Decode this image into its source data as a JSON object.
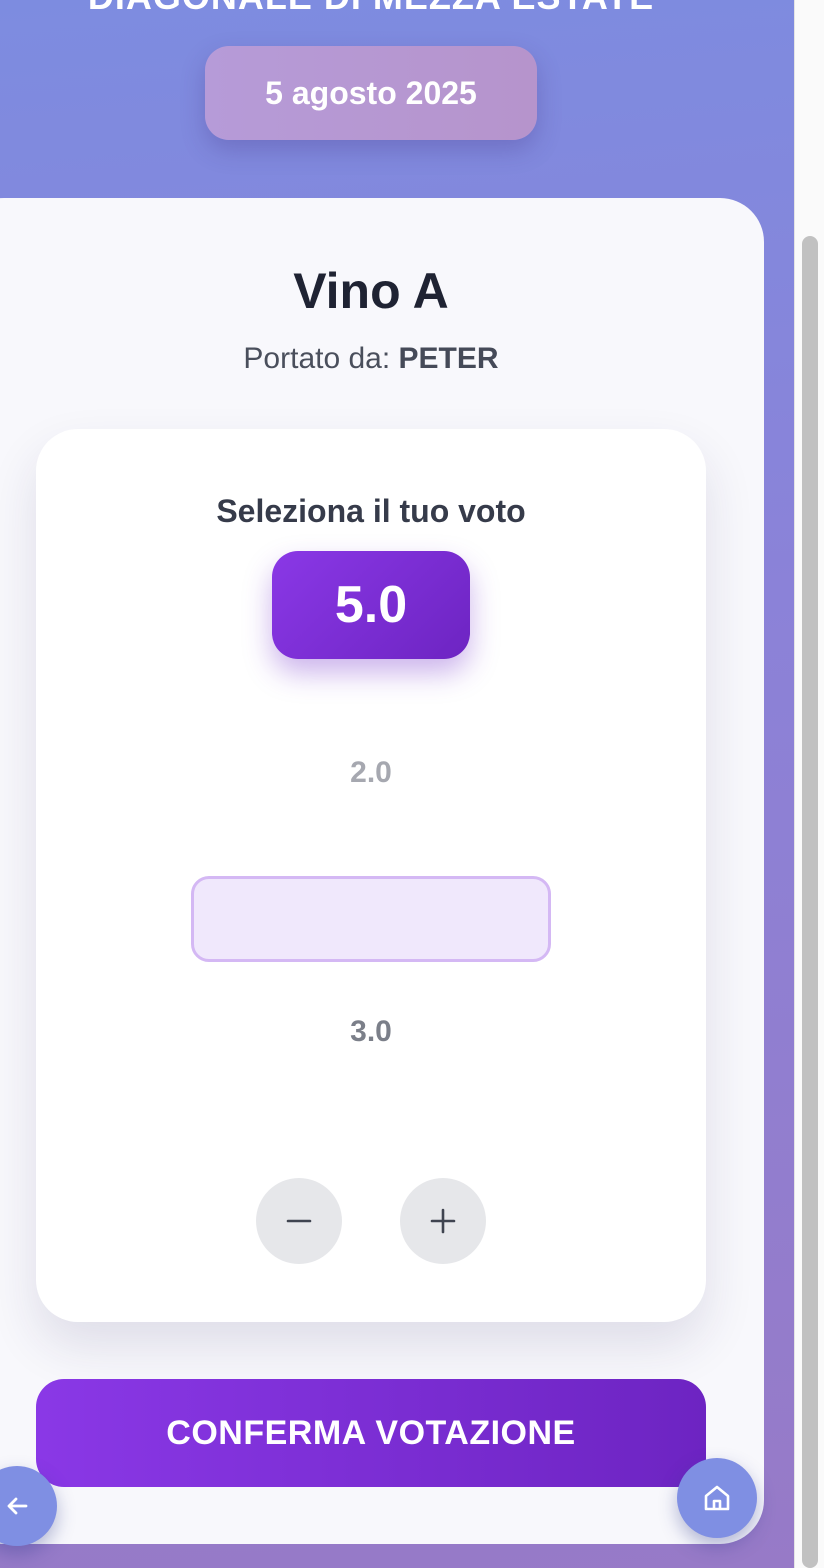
{
  "header": {
    "title": "DIAGONALE DI MEZZA ESTATE",
    "date": "5 agosto 2025"
  },
  "wine": {
    "name": "Vino A",
    "brought_by_label": "Portato da:",
    "brought_by_name": "PETER"
  },
  "vote": {
    "label": "Seleziona il tuo voto",
    "selected_value": "5.0",
    "picker_options": [
      "2.0",
      "3.0"
    ],
    "decrement_icon": "minus-icon",
    "increment_icon": "plus-icon"
  },
  "actions": {
    "confirm_label": "CONFERMA VOTAZIONE",
    "back_icon": "arrow-left-icon",
    "home_icon": "home-icon"
  },
  "colors": {
    "accent": "#7c2fd6",
    "background_start": "#7d8ce0",
    "background_end": "#977ac7",
    "fab": "#7f8fe3"
  }
}
